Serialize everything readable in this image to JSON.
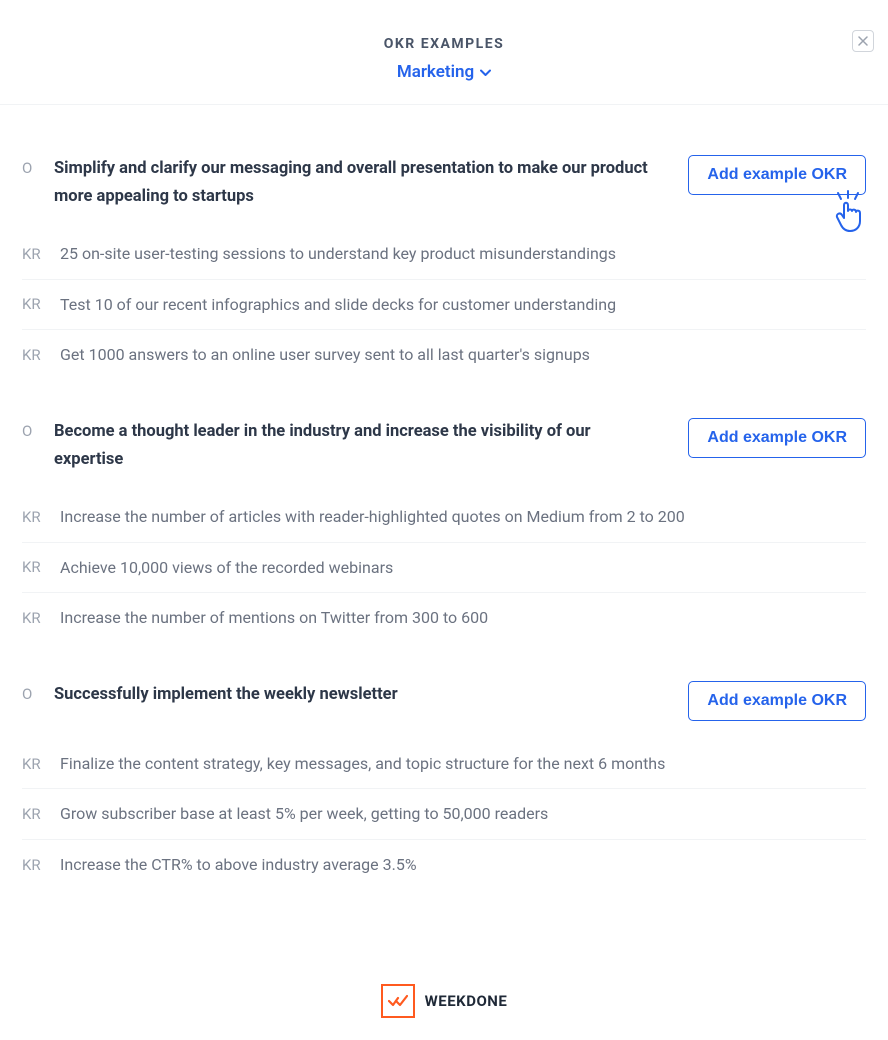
{
  "header": {
    "title": "OKR EXAMPLES",
    "dropdown_label": "Marketing"
  },
  "add_button_label": "Add example OKR",
  "okrs": [
    {
      "objective": "Simplify and clarify our messaging and overall presentation to make our product more appealing to startups",
      "show_pointer": true,
      "key_results": [
        "25 on-site user-testing sessions to understand key product misunderstandings",
        "Test 10 of our recent infographics and slide decks for customer understanding",
        "Get 1000 answers to an online user survey sent to all last quarter's signups"
      ]
    },
    {
      "objective": "Become a thought leader in the industry and increase the visibility of our expertise",
      "show_pointer": false,
      "key_results": [
        "Increase the number of articles with reader-highlighted quotes on Medium from 2 to 200",
        "Achieve 10,000 views of the recorded webinars",
        "Increase the number of mentions on Twitter from 300 to 600"
      ]
    },
    {
      "objective": "Successfully implement the weekly newsletter",
      "show_pointer": false,
      "key_results": [
        "Finalize the content strategy, key messages, and topic structure for the next 6 months",
        "Grow subscriber base at least 5% per week, getting to 50,000 readers",
        "Increase the CTR% to above industry average 3.5%"
      ]
    }
  ],
  "markers": {
    "objective": "O",
    "key_result": "KR"
  },
  "footer": {
    "brand": "WEEKDONE"
  }
}
